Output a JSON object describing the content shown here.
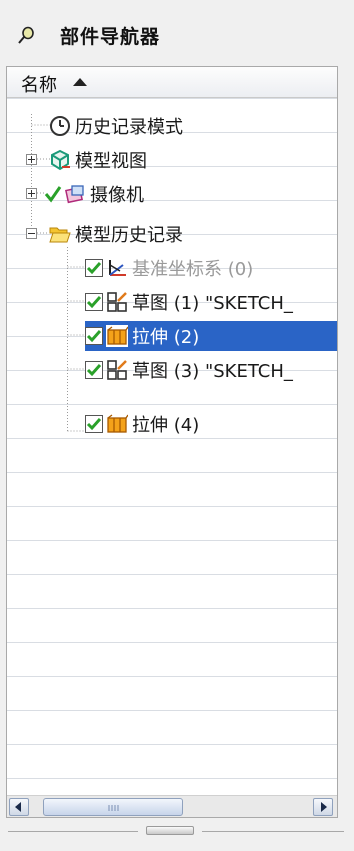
{
  "panel": {
    "title": "部件导航器"
  },
  "column": {
    "name_header": "名称"
  },
  "tree": {
    "history_mode": "历史记录模式",
    "model_views": "模型视图",
    "cameras": "摄像机",
    "model_history": "模型历史记录",
    "items": [
      {
        "label": "基准坐标系 (0)",
        "state": "grayed"
      },
      {
        "label": "草图 (1) \"SKETCH_",
        "state": "normal"
      },
      {
        "label": "拉伸 (2)",
        "state": "selected"
      },
      {
        "label": "草图 (3) \"SKETCH_",
        "state": "normal"
      },
      {
        "label": "拉伸 (4)",
        "state": "normal"
      }
    ]
  },
  "colors": {
    "selection": "#2a64c6",
    "check_green": "#2aa12a"
  },
  "icons": {
    "pin": "pin-icon",
    "clock": "clock-icon",
    "model_views": "views-icon",
    "camera": "camera-icon",
    "folder": "folder-open-icon",
    "datum_csys": "datum-csys-icon",
    "sketch": "sketch-icon",
    "extrude": "extrude-icon"
  }
}
